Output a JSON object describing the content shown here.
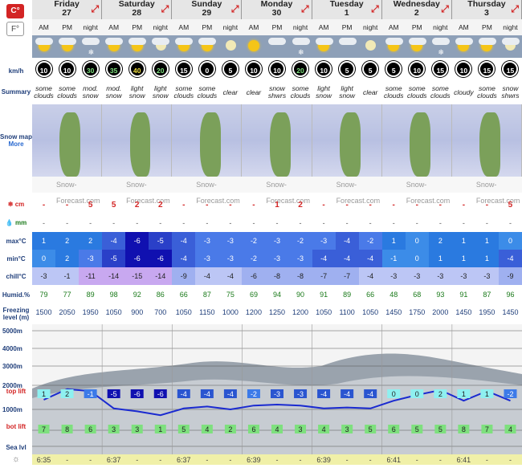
{
  "units": {
    "celsius": "C°",
    "fahrenheit": "F°"
  },
  "labels": {
    "wind": "km/h",
    "summary": "Summary",
    "snow_map": "Snow map",
    "more": "More",
    "snow_cm": "cm",
    "rain_mm": "mm",
    "max": "max°C",
    "min": "min°C",
    "chill": "chill°C",
    "humid": "Humid.%",
    "freezing": "Freezing level (m)",
    "top_lift": "top lift",
    "bot_lift": "bot lift",
    "sea_level": "Sea lvl"
  },
  "days": [
    {
      "name": "Friday",
      "date": "27"
    },
    {
      "name": "Saturday",
      "date": "28"
    },
    {
      "name": "Sunday",
      "date": "29"
    },
    {
      "name": "Monday",
      "date": "30"
    },
    {
      "name": "Tuesday",
      "date": "1"
    },
    {
      "name": "Wednesday",
      "date": "2"
    },
    {
      "name": "Thursday",
      "date": "3"
    }
  ],
  "periods": [
    "AM",
    "PM",
    "night",
    "AM",
    "PM",
    "night",
    "AM",
    "PM",
    "night",
    "AM",
    "PM",
    "night",
    "AM",
    "PM",
    "night",
    "AM",
    "PM",
    "night",
    "AM",
    "PM",
    "night"
  ],
  "weather_icons": [
    "sun-cloud",
    "sun-cloud",
    "snow-cloud",
    "sun-cloud",
    "sun-cloud",
    "moon-cloud",
    "sun-cloud",
    "sun-cloud",
    "moon",
    "sun",
    "cloud",
    "snow-cloud",
    "sun-cloud",
    "cloud",
    "moon",
    "sun-cloud",
    "sun-cloud",
    "snow-cloud",
    "sun-cloud",
    "sun-cloud",
    "moon-cloud"
  ],
  "wind": [
    "10",
    "10",
    "30",
    "35",
    "40",
    "20",
    "15",
    "0",
    "5",
    "10",
    "10",
    "20",
    "10",
    "5",
    "5",
    "5",
    "10",
    "15",
    "10",
    "15",
    "15"
  ],
  "wind_colors": [
    "#fff",
    "#fff",
    "#7ee07e",
    "#7ee07e",
    "#f0e040",
    "#7ee07e",
    "#fff",
    "#fff",
    "#fff",
    "#fff",
    "#fff",
    "#7ee07e",
    "#fff",
    "#fff",
    "#fff",
    "#fff",
    "#fff",
    "#fff",
    "#fff",
    "#fff",
    "#fff"
  ],
  "summary": [
    "some clouds",
    "some clouds",
    "mod. snow",
    "mod. snow",
    "light snow",
    "light snow",
    "some clouds",
    "some clouds",
    "clear",
    "clear",
    "snow shwrs",
    "some clouds",
    "light snow",
    "light snow",
    "clear",
    "some clouds",
    "some clouds",
    "some clouds",
    "cloudy",
    "some clouds",
    "snow shwrs"
  ],
  "watermark": "Snow-Forecast.com",
  "snow": [
    "-",
    "-",
    "5",
    "5",
    "2",
    "2",
    "-",
    "-",
    "-",
    "-",
    "1",
    "2",
    "-",
    "-",
    "-",
    "-",
    "-",
    "-",
    "-",
    "-",
    "5"
  ],
  "rain": [
    "-",
    "-",
    "-",
    "-",
    "-",
    "-",
    "-",
    "-",
    "-",
    "-",
    "-",
    "-",
    "-",
    "-",
    "-",
    "-",
    "-",
    "-",
    "-",
    "-",
    "-"
  ],
  "max_temp": [
    "1",
    "2",
    "2",
    "-4",
    "-6",
    "-5",
    "-4",
    "-3",
    "-3",
    "-2",
    "-3",
    "-2",
    "-3",
    "-4",
    "-2",
    "1",
    "0",
    "2",
    "1",
    "1",
    "0"
  ],
  "min_temp": [
    "0",
    "2",
    "-3",
    "-5",
    "-6",
    "-6",
    "-4",
    "-3",
    "-3",
    "-2",
    "-3",
    "-3",
    "-4",
    "-4",
    "-4",
    "-1",
    "0",
    "1",
    "1",
    "1",
    "-4"
  ],
  "chill": [
    "-3",
    "-1",
    "-11",
    "-14",
    "-15",
    "-14",
    "-9",
    "-4",
    "-4",
    "-6",
    "-8",
    "-8",
    "-7",
    "-7",
    "-4",
    "-3",
    "-3",
    "-3",
    "-3",
    "-3",
    "-9"
  ],
  "humidity": [
    "79",
    "77",
    "89",
    "98",
    "92",
    "86",
    "66",
    "87",
    "75",
    "69",
    "94",
    "90",
    "91",
    "89",
    "66",
    "48",
    "68",
    "93",
    "91",
    "87",
    "96"
  ],
  "freezing": [
    "1500",
    "2050",
    "1950",
    "1050",
    "900",
    "700",
    "1050",
    "1150",
    "1000",
    "1200",
    "1250",
    "1200",
    "1050",
    "1100",
    "1050",
    "1450",
    "1750",
    "2000",
    "1450",
    "1950",
    "1450"
  ],
  "altitudes": [
    "5000m",
    "4000m",
    "3000m",
    "2000m",
    "1000m"
  ],
  "top_lift": [
    "1",
    "2",
    "-1",
    "-5",
    "-6",
    "-6",
    "-4",
    "-4",
    "-4",
    "-2",
    "-3",
    "-3",
    "-4",
    "-4",
    "-4",
    "0",
    "0",
    "2",
    "1",
    "1",
    "-2"
  ],
  "bot_lift": [
    "7",
    "8",
    "6",
    "3",
    "3",
    "1",
    "5",
    "4",
    "2",
    "6",
    "4",
    "3",
    "4",
    "3",
    "5",
    "6",
    "5",
    "5",
    "8",
    "7",
    "4"
  ],
  "sunrise": [
    "6:35",
    "-",
    "-",
    "6:37",
    "-",
    "-",
    "6:37",
    "-",
    "-",
    "6:39",
    "-",
    "-",
    "6:39",
    "-",
    "-",
    "6:41",
    "-",
    "-",
    "6:41",
    "-",
    "-"
  ]
}
